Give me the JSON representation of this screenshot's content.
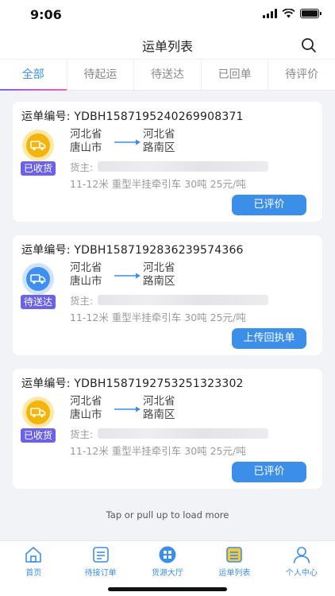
{
  "status_bar": {
    "time": "9:06"
  },
  "header": {
    "title": "运单列表"
  },
  "tabs": [
    {
      "label": "全部",
      "active": true
    },
    {
      "label": "待起运",
      "active": false
    },
    {
      "label": "待送达",
      "active": false
    },
    {
      "label": "已回单",
      "active": false
    },
    {
      "label": "待评价",
      "active": false
    }
  ],
  "cards": [
    {
      "order_no": "运单编号: YDBH1587195240269908371",
      "status": "已收货",
      "badge_color": "gold",
      "from_province": "河北省",
      "from_city": "唐山市",
      "to_province": "河北省",
      "to_city": "路南区",
      "owner_label": "货主:",
      "spec": "11-12米 重型半挂牵引车 30吨 25元/吨",
      "action": "已评价"
    },
    {
      "order_no": "运单编号: YDBH1587192836239574366",
      "status": "待送达",
      "badge_color": "blue",
      "from_province": "河北省",
      "from_city": "唐山市",
      "to_province": "河北省",
      "to_city": "路南区",
      "owner_label": "货主:",
      "spec": "11-12米 重型半挂牵引车 30吨 25元/吨",
      "action": "上传回执单"
    },
    {
      "order_no": "运单编号: YDBH1587192753251323302",
      "status": "已收货",
      "badge_color": "gold",
      "from_province": "河北省",
      "from_city": "唐山市",
      "to_province": "河北省",
      "to_city": "路南区",
      "owner_label": "货主:",
      "spec": "11-12米 重型半挂牵引车 30吨 25元/吨",
      "action": "已评价"
    }
  ],
  "load_more": "Tap or pull up to load more",
  "tabbar": [
    {
      "label": "首页",
      "icon": "home-icon"
    },
    {
      "label": "待接订单",
      "icon": "order-list-icon"
    },
    {
      "label": "货源大厅",
      "icon": "cargo-hall-icon"
    },
    {
      "label": "运单列表",
      "icon": "waybill-list-icon"
    },
    {
      "label": "个人中心",
      "icon": "user-icon"
    }
  ],
  "colors": {
    "accent": "#3b8fe8",
    "status_purple": "#6b62e8",
    "gold": "#f5b40a",
    "blue": "#3f8ff0"
  }
}
